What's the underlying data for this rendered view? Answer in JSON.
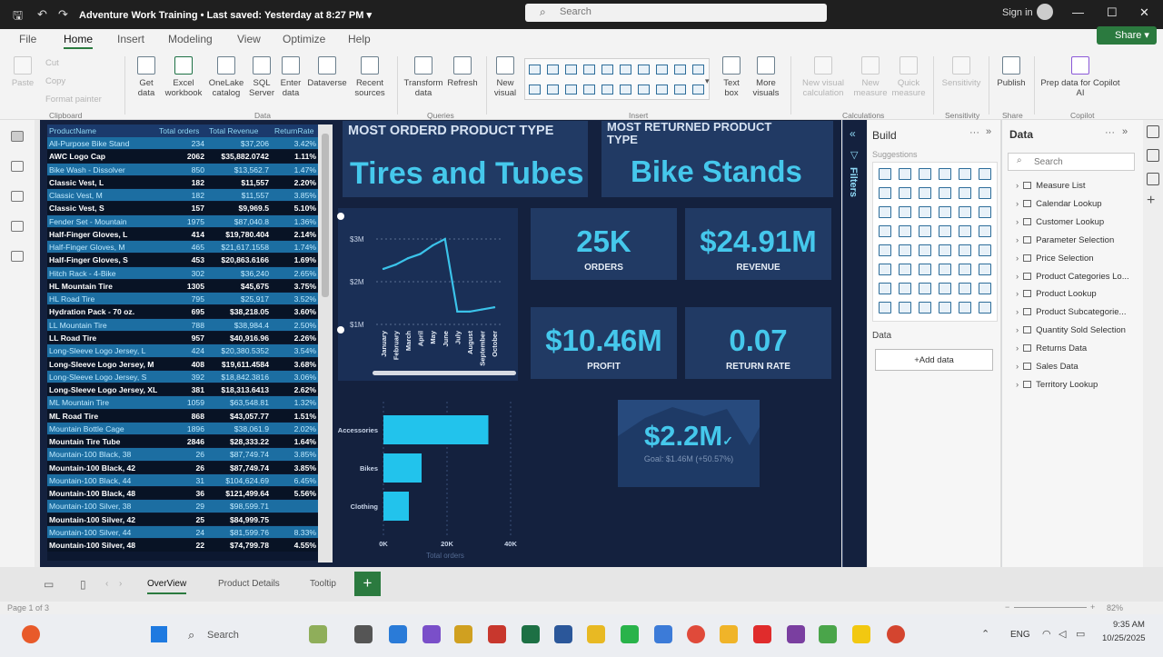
{
  "titlebar": {
    "title": "Adventure Work Training",
    "saved": "• Last saved: Yesterday at 8:27 PM",
    "search_placeholder": "Search",
    "signin": "Sign in"
  },
  "ribbon": {
    "tabs": [
      "File",
      "Home",
      "Insert",
      "Modeling",
      "View",
      "Optimize",
      "Help"
    ],
    "active_tab": "Home",
    "share": "Share",
    "clipboard": [
      "Paste",
      "Cut",
      "Copy",
      "Format painter"
    ],
    "buttons": [
      {
        "label": "Get\ndata"
      },
      {
        "label": "Excel\nworkbook"
      },
      {
        "label": "OneLake\ncatalog"
      },
      {
        "label": "SQL\nServer"
      },
      {
        "label": "Enter\ndata"
      },
      {
        "label": "Dataverse"
      },
      {
        "label": "Recent\nsources"
      },
      {
        "label": "Transform\ndata"
      },
      {
        "label": "Refresh"
      },
      {
        "label": "New\nvisual"
      },
      {
        "label": "Text\nbox"
      },
      {
        "label": "More\nvisuals"
      },
      {
        "label": "New visual\ncalculation"
      },
      {
        "label": "New\nmeasure"
      },
      {
        "label": "Quick\nmeasure"
      },
      {
        "label": "Sensitivity"
      },
      {
        "label": "Publish"
      },
      {
        "label": "Prep data for Copilot\nAI"
      }
    ],
    "groups": [
      "Clipboard",
      "Data",
      "Queries",
      "Insert",
      "Calculations",
      "Sensitivity",
      "Share",
      "Copilot"
    ]
  },
  "table": {
    "headers": [
      "ProductName",
      "Total orders",
      "Total Revenue",
      "ReturnRate"
    ],
    "rows": [
      [
        "All-Purpose Bike Stand",
        "234",
        "$37,206",
        "3.42%"
      ],
      [
        "AWC Logo Cap",
        "2062",
        "$35,882.0742",
        "1.11%"
      ],
      [
        "Bike Wash - Dissolver",
        "850",
        "$13,562.7",
        "1.47%"
      ],
      [
        "Classic Vest, L",
        "182",
        "$11,557",
        "2.20%"
      ],
      [
        "Classic Vest, M",
        "182",
        "$11,557",
        "3.85%"
      ],
      [
        "Classic Vest, S",
        "157",
        "$9,969.5",
        "5.10%"
      ],
      [
        "Fender Set - Mountain",
        "1975",
        "$87,040.8",
        "1.36%"
      ],
      [
        "Half-Finger Gloves, L",
        "414",
        "$19,780.404",
        "2.14%"
      ],
      [
        "Half-Finger Gloves, M",
        "465",
        "$21,617.1558",
        "1.74%"
      ],
      [
        "Half-Finger Gloves, S",
        "453",
        "$20,863.6166",
        "1.69%"
      ],
      [
        "Hitch Rack - 4-Bike",
        "302",
        "$36,240",
        "2.65%"
      ],
      [
        "HL Mountain Tire",
        "1305",
        "$45,675",
        "3.75%"
      ],
      [
        "HL Road Tire",
        "795",
        "$25,917",
        "3.52%"
      ],
      [
        "Hydration Pack - 70 oz.",
        "695",
        "$38,218.05",
        "3.60%"
      ],
      [
        "LL Mountain Tire",
        "788",
        "$38,984.4",
        "2.50%"
      ],
      [
        "LL Road Tire",
        "957",
        "$40,916.96",
        "2.26%"
      ],
      [
        "Long-Sleeve Logo Jersey, L",
        "424",
        "$20,380.5352",
        "3.54%"
      ],
      [
        "Long-Sleeve Logo Jersey, M",
        "408",
        "$19,611.4584",
        "3.68%"
      ],
      [
        "Long-Sleeve Logo Jersey, S",
        "392",
        "$18,842.3816",
        "3.06%"
      ],
      [
        "Long-Sleeve Logo Jersey, XL",
        "381",
        "$18,313.6413",
        "2.62%"
      ],
      [
        "ML Mountain Tire",
        "1059",
        "$63,548.81",
        "1.32%"
      ],
      [
        "ML Road Tire",
        "868",
        "$43,057.77",
        "1.51%"
      ],
      [
        "Mountain Bottle Cage",
        "1896",
        "$38,061.9",
        "2.02%"
      ],
      [
        "Mountain Tire Tube",
        "2846",
        "$28,333.22",
        "1.64%"
      ],
      [
        "Mountain-100 Black, 38",
        "26",
        "$87,749.74",
        "3.85%"
      ],
      [
        "Mountain-100 Black, 42",
        "26",
        "$87,749.74",
        "3.85%"
      ],
      [
        "Mountain-100 Black, 44",
        "31",
        "$104,624.69",
        "6.45%"
      ],
      [
        "Mountain-100 Black, 48",
        "36",
        "$121,499.64",
        "5.56%"
      ],
      [
        "Mountain-100 Silver, 38",
        "29",
        "$98,599.71",
        ""
      ],
      [
        "Mountain-100 Silver, 42",
        "25",
        "$84,999.75",
        ""
      ],
      [
        "Mountain-100 Silver, 44",
        "24",
        "$81,599.76",
        "8.33%"
      ],
      [
        "Mountain-100 Silver, 48",
        "22",
        "$74,799.78",
        "4.55%"
      ]
    ],
    "highlight_rows": [
      0,
      2,
      4,
      6,
      8,
      10,
      12,
      14,
      16,
      18,
      20,
      22,
      24,
      26,
      28,
      30
    ]
  },
  "cards": {
    "most_ordered_title": "MOST ORDERD PRODUCT TYPE",
    "most_ordered_value": "Tires and Tubes",
    "most_returned_title": "MOST RETURNED PRODUCT TYPE",
    "most_returned_value": "Bike Stands",
    "orders_value": "25K",
    "orders_label": "ORDERS",
    "revenue_value": "$24.91M",
    "revenue_label": "REVENUE",
    "profit_value": "$10.46M",
    "profit_label": "PROFIT",
    "return_value": "0.07",
    "return_label": "RETURN RATE",
    "kpi_value": "$2.2M",
    "kpi_goal": "Goal: $1.46M (+50.57%)"
  },
  "chart_data": [
    {
      "type": "line",
      "x": [
        "January",
        "February",
        "March",
        "April",
        "May",
        "June",
        "July",
        "August",
        "September",
        "October"
      ],
      "values": [
        2.3,
        2.4,
        2.55,
        2.65,
        2.85,
        3.0,
        1.3,
        1.3,
        1.35,
        1.4
      ],
      "y_ticks": [
        "$3M",
        "$2M",
        "$1M"
      ],
      "ylim": [
        1,
        3
      ]
    },
    {
      "type": "bar",
      "orientation": "horizontal",
      "categories": [
        "Accessories",
        "Bikes",
        "Clothing"
      ],
      "values": [
        33000,
        12000,
        8000
      ],
      "x_ticks": [
        "0K",
        "20K",
        "40K"
      ],
      "xlim": [
        0,
        40000
      ],
      "xlabel": "Total orders"
    }
  ],
  "pane_build": {
    "title": "Build",
    "suggestions": "Suggestions",
    "data_label": "Data",
    "add_data": "+Add data"
  },
  "pane_data": {
    "title": "Data",
    "search": "Search",
    "tables": [
      "Measure List",
      "Calendar Lookup",
      "Customer Lookup",
      "Parameter Selection",
      "Price Selection",
      "Product Categories Lo...",
      "Product Lookup",
      "Product Subcategorie...",
      "Quantity Sold Selection",
      "Returns Data",
      "Sales Data",
      "Territory Lookup"
    ]
  },
  "filters_label": "Filters",
  "page_tabs": [
    "OverView",
    "Product Details",
    "Tooltip"
  ],
  "active_page": "OverView",
  "status": {
    "page": "Page 1 of 3",
    "zoom": "82%"
  },
  "taskbar": {
    "search": "Search",
    "lang": "ENG",
    "time": "9:35 AM",
    "date": "10/25/2025"
  }
}
